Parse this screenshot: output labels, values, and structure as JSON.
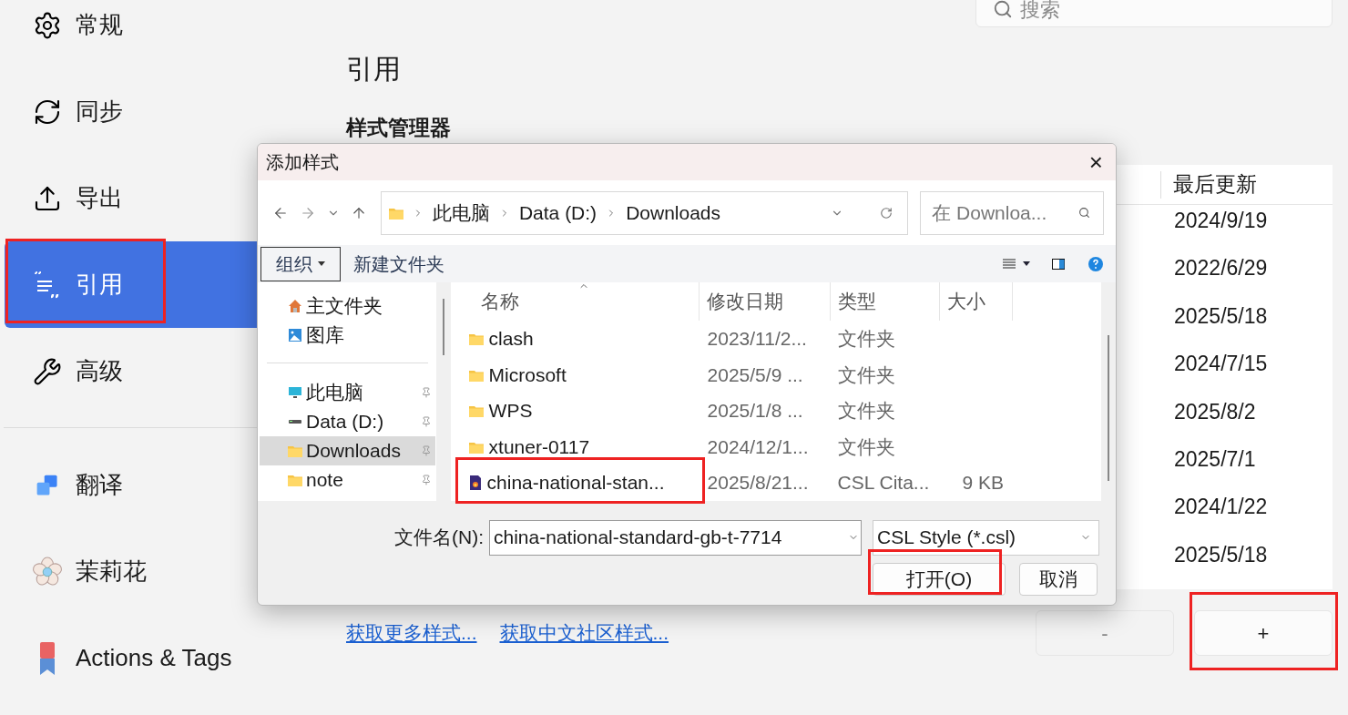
{
  "sidebar": {
    "sections": [
      {
        "items": [
          {
            "label": "常规",
            "kind": "gear",
            "selected": false
          },
          {
            "label": "同步",
            "kind": "sync",
            "selected": false
          },
          {
            "label": "导出",
            "kind": "export",
            "selected": false
          },
          {
            "label": "引用",
            "kind": "quote",
            "selected": true
          },
          {
            "label": "高级",
            "kind": "tools",
            "selected": false
          }
        ]
      },
      {
        "items": [
          {
            "label": "翻译",
            "kind": "translate",
            "selected": false
          },
          {
            "label": "茉莉花",
            "kind": "flower",
            "selected": false
          },
          {
            "label": "Actions & Tags",
            "kind": "bookmark",
            "selected": false
          }
        ]
      }
    ]
  },
  "search": {
    "placeholder": "搜索"
  },
  "page": {
    "title": "引用",
    "section_title": "样式管理器",
    "table": {
      "columns": [
        "最后更新"
      ],
      "rows": [
        {
          "last_updated": "2024/9/19"
        },
        {
          "last_updated": "2022/6/29"
        },
        {
          "last_updated": "2025/5/18"
        },
        {
          "last_updated": "2024/7/15"
        },
        {
          "last_updated": "2025/8/2"
        },
        {
          "last_updated": "2025/7/1"
        },
        {
          "last_updated": "2024/1/22"
        },
        {
          "last_updated": "2025/5/18"
        }
      ]
    },
    "links": [
      "获取更多样式...",
      "获取中文社区样式..."
    ],
    "buttons": [
      "-",
      "+"
    ]
  },
  "dialog": {
    "title": "添加样式",
    "close": "×",
    "breadcrumb": [
      "此电脑",
      "Data (D:)",
      "Downloads"
    ],
    "search": {
      "placeholder": "在 Downloa..."
    },
    "toolbar": {
      "organize": "组织",
      "new_folder": "新建文件夹"
    },
    "nav": {
      "sections": [
        {
          "items": [
            {
              "label": "主文件夹",
              "kind": "home",
              "selected": false,
              "pinned": false
            },
            {
              "label": "图库",
              "kind": "gallery",
              "selected": false,
              "pinned": false
            }
          ]
        },
        {
          "items": [
            {
              "label": "此电脑",
              "kind": "computer",
              "selected": false,
              "pinned": true
            },
            {
              "label": "Data (D:)",
              "kind": "drive",
              "selected": false,
              "pinned": true
            },
            {
              "label": "Downloads",
              "kind": "folder",
              "selected": true,
              "pinned": true
            },
            {
              "label": "note",
              "kind": "folder",
              "selected": false,
              "pinned": true
            }
          ]
        }
      ]
    },
    "files": {
      "columns": [
        "名称",
        "修改日期",
        "类型",
        "大小"
      ],
      "rows": [
        {
          "name": "clash",
          "modified": "2023/11/2...",
          "type": "文件夹",
          "kind": "folder"
        },
        {
          "name": "Microsoft",
          "modified": "2025/5/9 ...",
          "type": "文件夹",
          "kind": "folder"
        },
        {
          "name": "WPS",
          "modified": "2025/1/8 ...",
          "type": "文件夹",
          "kind": "folder"
        },
        {
          "name": "xtuner-0117",
          "modified": "2024/12/1...",
          "type": "文件夹",
          "kind": "folder"
        },
        {
          "name": "china-national-stan...",
          "modified": "2025/8/21...",
          "type": "CSL Cita...",
          "size": "9 KB",
          "kind": "csl"
        }
      ]
    },
    "file_name": {
      "label": "文件名(N):",
      "value": "china-national-standard-gb-t-7714"
    },
    "file_type": {
      "value": "CSL Style (*.csl)"
    },
    "buttons": [
      "打开(O)",
      "取消"
    ]
  }
}
